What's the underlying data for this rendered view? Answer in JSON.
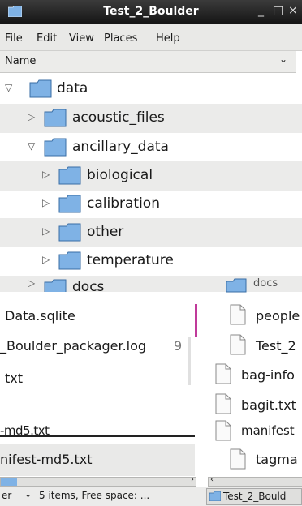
{
  "window": {
    "title": "Test_2_Boulder",
    "controls": [
      "_",
      "□",
      "×"
    ]
  },
  "menu": [
    "File",
    "Edit",
    "View",
    "Places",
    "Help"
  ],
  "columns": {
    "name": "Name"
  },
  "tree": [
    {
      "label": "data",
      "level": 0,
      "expanded": true
    },
    {
      "label": "acoustic_files",
      "level": 1,
      "expanded": false
    },
    {
      "label": "ancillary_data",
      "level": 1,
      "expanded": true
    },
    {
      "label": "biological",
      "level": 2,
      "expanded": false
    },
    {
      "label": "calibration",
      "level": 2,
      "expanded": false
    },
    {
      "label": "other",
      "level": 2,
      "expanded": false
    },
    {
      "label": "temperature",
      "level": 2,
      "expanded": false
    },
    {
      "label": "docs",
      "level": 1,
      "expanded": false
    }
  ],
  "left_pane": [
    "Data.sqlite",
    "_Boulder_packager.log",
    "txt",
    "",
    "-md5.txt",
    "nifest-md5.txt"
  ],
  "left_pane_extra": {
    "log_suffix": "9"
  },
  "right_pane": {
    "header_fragment": "docs",
    "files": [
      "people",
      "Test_2",
      "bag-info",
      "bagit.txt",
      "manifest",
      "tagma"
    ]
  },
  "status": {
    "view_select": "er",
    "text": "5 items, Free space: ...",
    "taskbar_item": "Test_2_Bould"
  },
  "colors": {
    "folder_blue": "#7fb2e5",
    "titlebar": "#1e1e1e",
    "row_alt": "#ebebea"
  }
}
